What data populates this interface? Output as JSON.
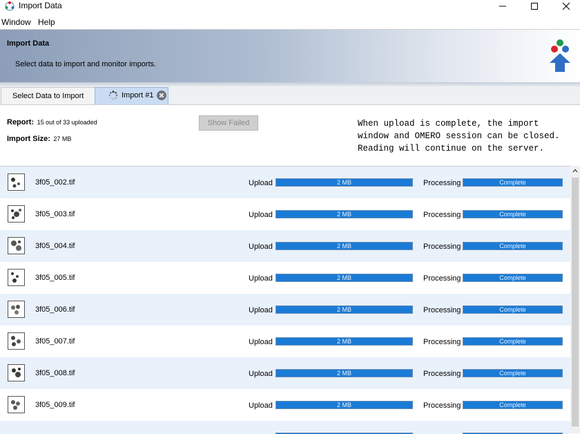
{
  "window": {
    "title": "Import Data"
  },
  "menu": {
    "items": [
      "Window",
      "Help"
    ]
  },
  "banner": {
    "title": "Import Data",
    "description": "Select data to import and monitor imports."
  },
  "tabs": [
    {
      "label": "Select Data to Import",
      "active": false
    },
    {
      "label": "Import #1",
      "active": true
    }
  ],
  "summary": {
    "report_label": "Report:",
    "report_value": "15 out of 33 uploaded",
    "size_label": "Import Size:",
    "size_value": "27 MB",
    "show_failed_label": "Show Failed",
    "notice": "When upload is complete, the import\nwindow and OMERO session can be closed.\nReading will continue on the server."
  },
  "files": [
    {
      "name": "3f05_002.tif",
      "upload_label": "Upload",
      "upload_text": "2 MB",
      "upload_progress": 1.0,
      "processing_label": "Processing",
      "processing_text": "Complete"
    },
    {
      "name": "3f05_003.tif",
      "upload_label": "Upload",
      "upload_text": "2 MB",
      "upload_progress": 1.0,
      "processing_label": "Processing",
      "processing_text": "Complete"
    },
    {
      "name": "3f05_004.tif",
      "upload_label": "Upload",
      "upload_text": "2 MB",
      "upload_progress": 1.0,
      "processing_label": "Processing",
      "processing_text": "Complete"
    },
    {
      "name": "3f05_005.tif",
      "upload_label": "Upload",
      "upload_text": "2 MB",
      "upload_progress": 1.0,
      "processing_label": "Processing",
      "processing_text": "Complete"
    },
    {
      "name": "3f05_006.tif",
      "upload_label": "Upload",
      "upload_text": "2 MB",
      "upload_progress": 1.0,
      "processing_label": "Processing",
      "processing_text": "Complete"
    },
    {
      "name": "3f05_007.tif",
      "upload_label": "Upload",
      "upload_text": "2 MB",
      "upload_progress": 1.0,
      "processing_label": "Processing",
      "processing_text": "Complete"
    },
    {
      "name": "3f05_008.tif",
      "upload_label": "Upload",
      "upload_text": "2 MB",
      "upload_progress": 1.0,
      "processing_label": "Processing",
      "processing_text": "Complete"
    },
    {
      "name": "3f05_009.tif",
      "upload_label": "Upload",
      "upload_text": "2 MB",
      "upload_progress": 1.0,
      "processing_label": "Processing",
      "processing_text": "Complete"
    }
  ],
  "colors": {
    "progress_fill": "#1a7bd6",
    "row_alt": "#e9f1fb",
    "banner_left": "#8c9eb8"
  },
  "icons": {
    "app": "omero-app-icon",
    "logo": "omero-import-logo-icon",
    "tab_spinner": "loading-spinner-icon",
    "tab_close": "close-tab-icon",
    "file": "image-thumbnail-icon"
  }
}
